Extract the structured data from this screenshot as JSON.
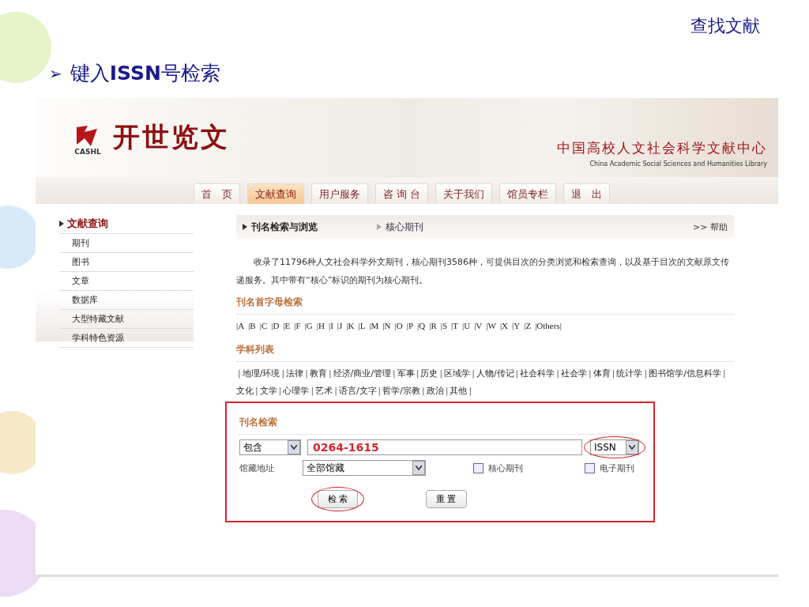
{
  "slide": {
    "corner_title": "查找文献",
    "bullet": "➢",
    "heading": "键入**ISSN**号检索"
  },
  "banner": {
    "logo_text": "开世览文",
    "logo_caption": "CASHL",
    "org_name_cn": "中国高校人文社会科学文献中心",
    "org_name_en": "China Academic Social Sciences and Humanities Library"
  },
  "nav": [
    {
      "label": "首　页",
      "selected": false
    },
    {
      "label": "文献查询",
      "selected": true
    },
    {
      "label": "用户服务",
      "selected": false
    },
    {
      "label": "咨 询 台",
      "selected": false
    },
    {
      "label": "关于我们",
      "selected": false
    },
    {
      "label": "馆员专栏",
      "selected": false
    },
    {
      "label": "退　出",
      "selected": false
    }
  ],
  "sidebar": {
    "title": "文献查询",
    "items": [
      "期刊",
      "图书",
      "文章",
      "数据库",
      "大型特藏文献",
      "学科特色资源"
    ]
  },
  "panel_header": {
    "tabs": [
      {
        "label": "刊名检索与浏览",
        "selected": true
      },
      {
        "label": "核心期刊",
        "selected": false
      }
    ],
    "help": ">> 帮助"
  },
  "intro": "收录了11796种人文社会科学外文期刊，核心期刊3586种，可提供目次的分类浏览和检索查询，以及基于目次的文献原文传递服务。其中带有“核心”标识的期刊为核心期刊。",
  "letter_section": {
    "title": "刊名首字母检索",
    "letters": [
      "|A",
      "|B",
      "|C",
      "|D",
      "|E",
      "|F",
      "|G",
      "|H",
      "|I",
      "|J",
      "|K",
      "|L",
      "|M",
      "|N",
      "|O",
      "|P",
      "|Q",
      "|R",
      "|S",
      "|T",
      "|U",
      "|V",
      "|W",
      "|X",
      "|Y",
      "|Z",
      "|Others|"
    ]
  },
  "subject_section": {
    "title": "学科列表",
    "separator": "|",
    "subjects": [
      "地理/环境",
      "法律",
      "教育",
      "经济/商业/管理",
      "军事",
      "历史",
      "区域学",
      "人物/传记",
      "社会科学",
      "社会学",
      "体育",
      "统计学",
      "图书馆学/信息科学",
      "文化",
      "文学",
      "心理学",
      "艺术",
      "语言/文字",
      "哲学/宗教",
      "政治",
      "其他"
    ]
  },
  "search_form": {
    "title": "刊名检索",
    "outlined": true,
    "match_select": "包含",
    "query": "0264-1615",
    "field_select": {
      "value": "ISSN",
      "circled": true
    },
    "location_label": "馆藏地址",
    "location_select": "全部馆藏",
    "checkboxes": [
      {
        "label": "核心期刊",
        "checked": false
      },
      {
        "label": "电子期刊",
        "checked": false
      }
    ],
    "buttons": [
      {
        "label": "检 索",
        "circled": true
      },
      {
        "label": "重 置",
        "circled": false
      }
    ]
  }
}
